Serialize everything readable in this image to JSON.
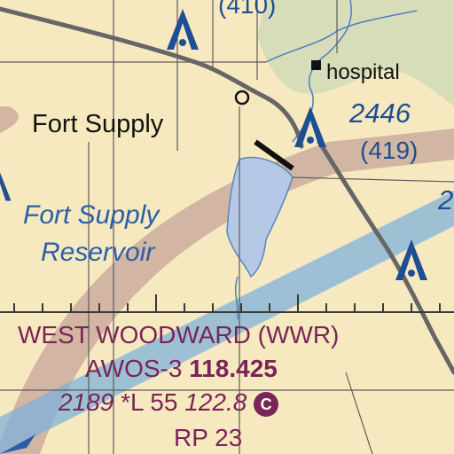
{
  "colors": {
    "land": "#f6e9bf",
    "river_valley": "#d7ddb8",
    "lake_fill": "#b5c9e6",
    "road": "#666666",
    "section_line": "#5c5c5c",
    "water_text": "#2a5fa8",
    "airspace_blue": "#1f4f93",
    "airport_magenta": "#7a2458",
    "mva_band": "#b58a8a",
    "victor_airway": "#7fb2dc"
  },
  "labels": {
    "town": "Fort Supply",
    "reservoir_line1": "Fort Supply",
    "reservoir_line2": "Reservoir",
    "hospital": "hospital",
    "top_partial": "(410)",
    "obstacle_msl": "2446",
    "obstacle_agl": "(419)",
    "top_right_partial": "2"
  },
  "airport": {
    "name": "WEST WOODWARD (WWR)",
    "awos_label": "AWOS-3",
    "awos_freq": "118.425",
    "elevation": "2189",
    "lighting": "*L",
    "runway_length": "55",
    "ctaf": "122.8",
    "ctaf_symbol": "C",
    "pattern": "RP 23"
  },
  "icons": [
    "obstacle-icon",
    "hospital-icon",
    "road-marker-icon"
  ]
}
